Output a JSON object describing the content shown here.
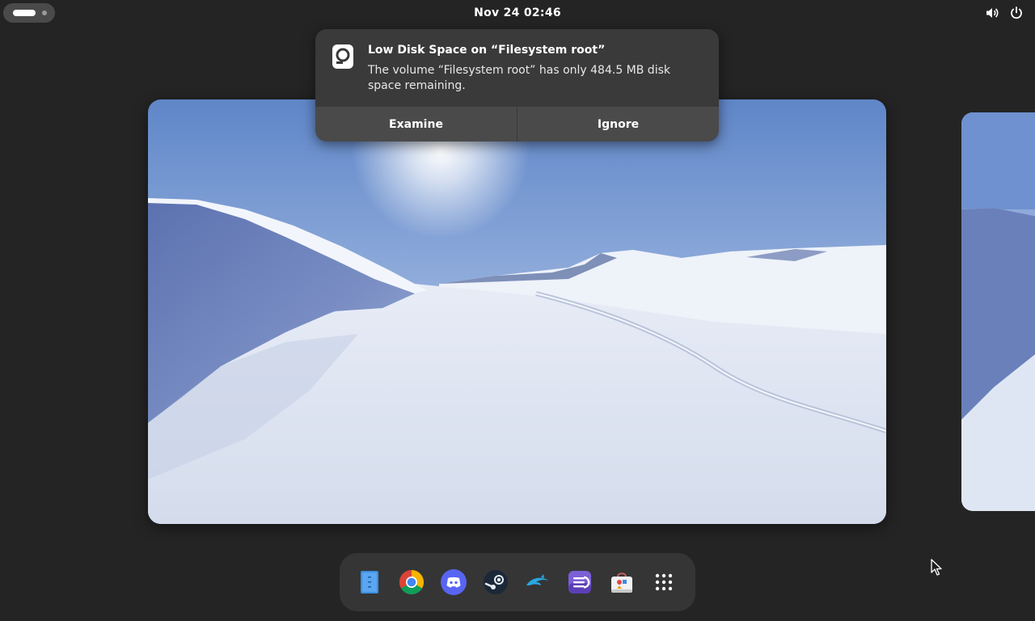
{
  "topbar": {
    "clock": "Nov 24  02:46",
    "icons": [
      "activities-indicator",
      "volume-icon",
      "power-icon"
    ]
  },
  "notification": {
    "icon": "disk-icon",
    "title": "Low Disk Space on “Filesystem root”",
    "body": "The volume “Filesystem root” has only 484.5 MB disk space remaining.",
    "actions": {
      "examine": "Examine",
      "ignore": "Ignore"
    }
  },
  "dock": {
    "items": [
      "files-icon",
      "chrome-icon",
      "discord-icon",
      "steam-icon",
      "dolphin-icon",
      "gnome-tweaks-icon",
      "software-store-icon",
      "app-grid-icon"
    ]
  },
  "colors": {
    "background": "#242424",
    "panel": "#3a3a3a",
    "button": "#4a4a4a",
    "dock": "#353535"
  }
}
